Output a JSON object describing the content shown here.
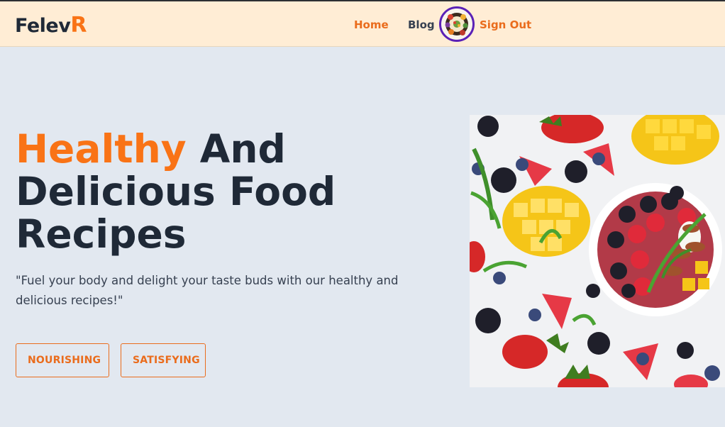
{
  "brand": {
    "name_main": "Felev",
    "name_accent": "R"
  },
  "nav": {
    "home": "Home",
    "blog": "Blog",
    "signout": "Sign Out"
  },
  "hero": {
    "title_highlight": "Healthy",
    "title_rest_1": " And",
    "title_rest_2": "Delicious Food",
    "title_rest_3": "Recipes",
    "description": "\"Fuel your body and delight your taste buds with our healthy and delicious recipes!\"",
    "tags": [
      "NOURISHING",
      "SATISFYING"
    ]
  },
  "colors": {
    "accent": "#f97316",
    "navbar_bg": "#ffedd5",
    "page_bg": "#e2e8f0",
    "heading": "#1f2937",
    "avatar_ring": "#5b21b6"
  },
  "images": {
    "avatar": "profile-avatar-food-plate",
    "hero": "fruit-bowl-berries-mango-strawberries"
  }
}
